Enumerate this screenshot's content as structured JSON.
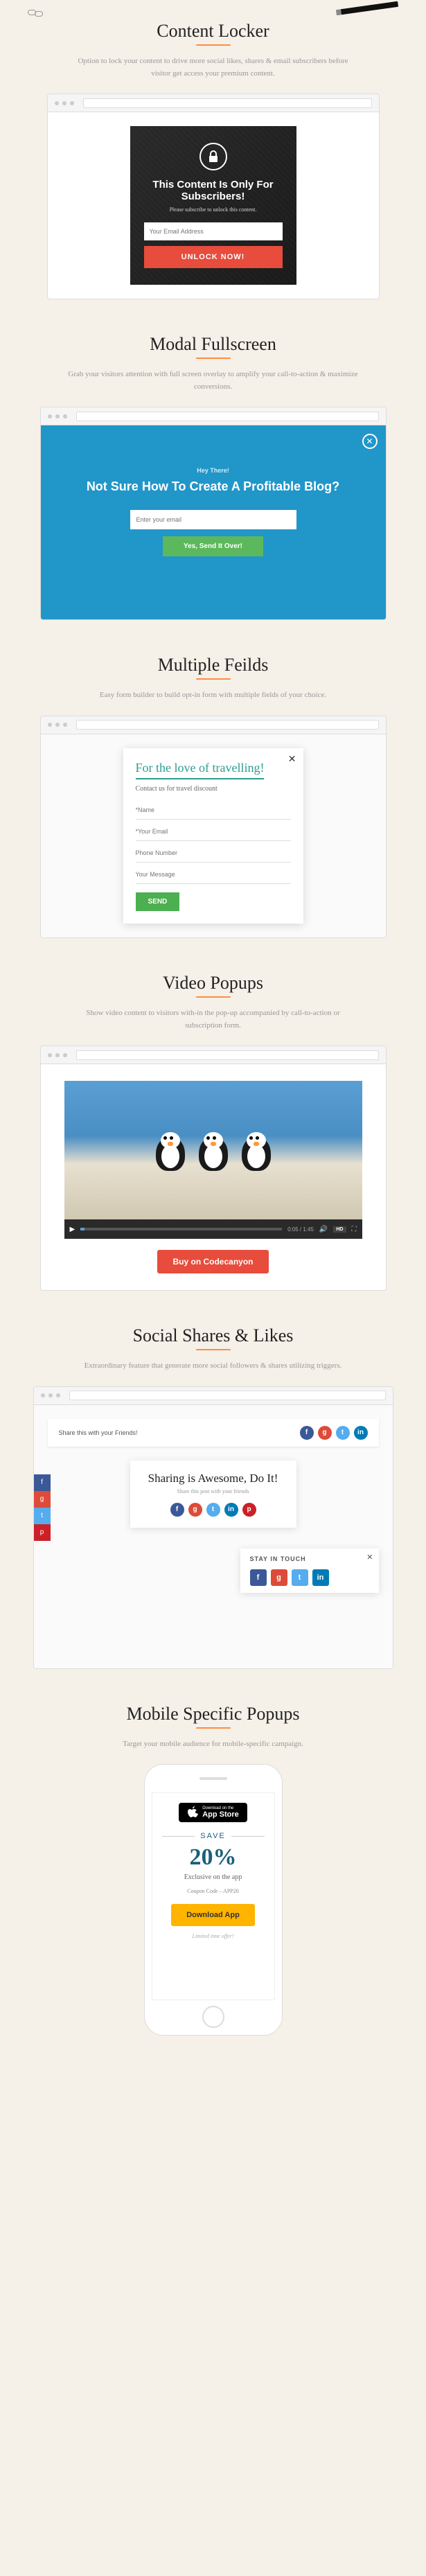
{
  "sections": {
    "locker": {
      "title": "Content Locker",
      "desc": "Option to lock your content to drive more social likes, shares & email subscribers before visitor get access your premium content.",
      "panel_title": "This Content Is Only For Subscribers!",
      "panel_sub": "Please subscribe to unlock this content.",
      "placeholder": "Your Email Address",
      "button": "UNLOCK NOW!"
    },
    "modal": {
      "title": "Modal Fullscreen",
      "desc": "Grab your visitors attention with full screen overlay to amplify your call-to-action & maximize conversions.",
      "hey": "Hey There!",
      "headline": "Not Sure How To Create A Profitable Blog?",
      "placeholder": "Enter your email",
      "button": "Yes, Send It Over!"
    },
    "fields": {
      "title": "Multiple Feilds",
      "desc": "Easy form builder to build opt-in form with multiple fields of your choice.",
      "popup_title": "For the love of travelling!",
      "popup_sub": "Contact us for travel discount",
      "f1": "*Name",
      "f2": "*Your Email",
      "f3": "Phone Number",
      "f4": "Your Message",
      "button": "SEND"
    },
    "video": {
      "title": "Video Popups",
      "desc": "Show video content to visitors with-in the pop-up accompanied by call-to-action or subscription form.",
      "time": "0:05 / 1:45",
      "hd": "HD",
      "button": "Buy on Codecanyon"
    },
    "social": {
      "title": "Social Shares & Likes",
      "desc": "Extraordinary feature that generate more social followers & shares utilizing triggers.",
      "bar_text": "Share this with your Friends!",
      "card_title": "Sharing is Awesome, Do It!",
      "card_sub": "Share this post with your friends",
      "stay_title": "STAY IN TOUCH"
    },
    "mobile": {
      "title": "Mobile Specific Popups",
      "desc": "Target your mobile audience for mobile-specific campaign.",
      "store_small": "Download on the",
      "store_big": "App Store",
      "save": "SAVE",
      "pct": "20%",
      "excl": "Exclusive on the app",
      "coupon": "Coupon Code – APP20",
      "button": "Download App",
      "limited": "Limited time offer!"
    }
  }
}
